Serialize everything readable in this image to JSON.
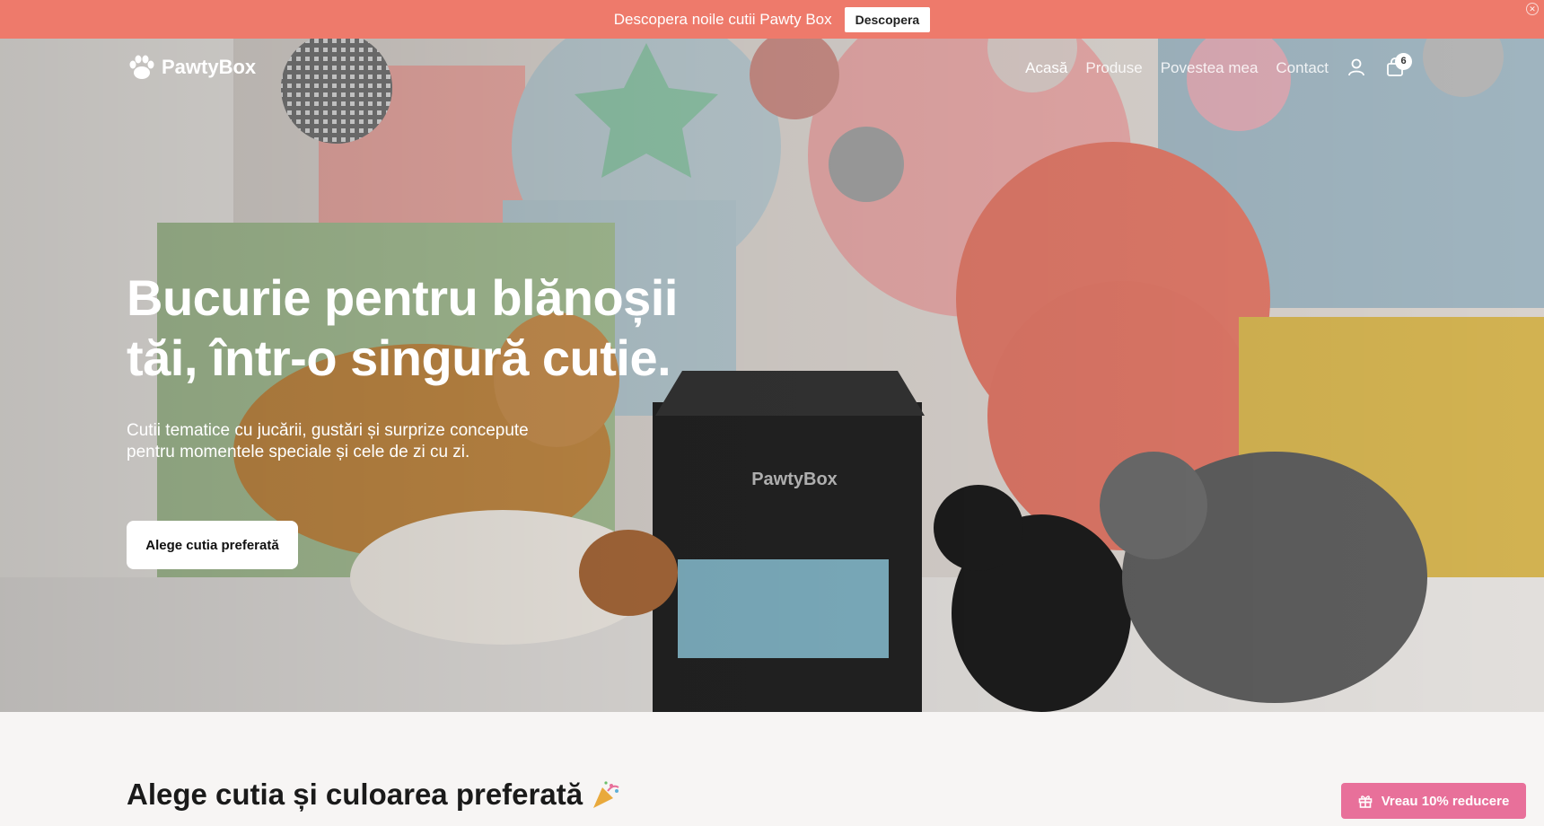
{
  "announcement": {
    "text": "Descopera noile cutii Pawty Box",
    "button": "Descopera",
    "close_icon": "close-icon"
  },
  "header": {
    "logo_text": "PawtyBox",
    "logo_icon": "paw-icon",
    "nav": [
      {
        "label": "Acasă",
        "active": true
      },
      {
        "label": "Produse",
        "active": false
      },
      {
        "label": "Povestea mea",
        "active": false
      },
      {
        "label": "Contact",
        "active": false
      }
    ],
    "account_icon": "user-icon",
    "cart_icon": "shopping-bag-icon",
    "cart_count": "6"
  },
  "hero": {
    "title": "Bucurie pentru blănoșii tăi, într-o singură cutie.",
    "subtitle": "Cutii tematice cu jucării, gustări și surprize concepute pentru momentele speciale și cele de zi cu zi.",
    "cta": "Alege cutia preferată",
    "box_brand": "PawtyBox"
  },
  "section": {
    "title": "Alege cutia și culoarea preferată",
    "emoji_icon": "party-popper-icon"
  },
  "discount": {
    "label": "Vreau 10% reducere",
    "icon": "gift-icon"
  },
  "colors": {
    "announce_bg": "#ee7a6b",
    "discount_bg": "#e8709a",
    "page_bg": "#f7f5f4"
  }
}
